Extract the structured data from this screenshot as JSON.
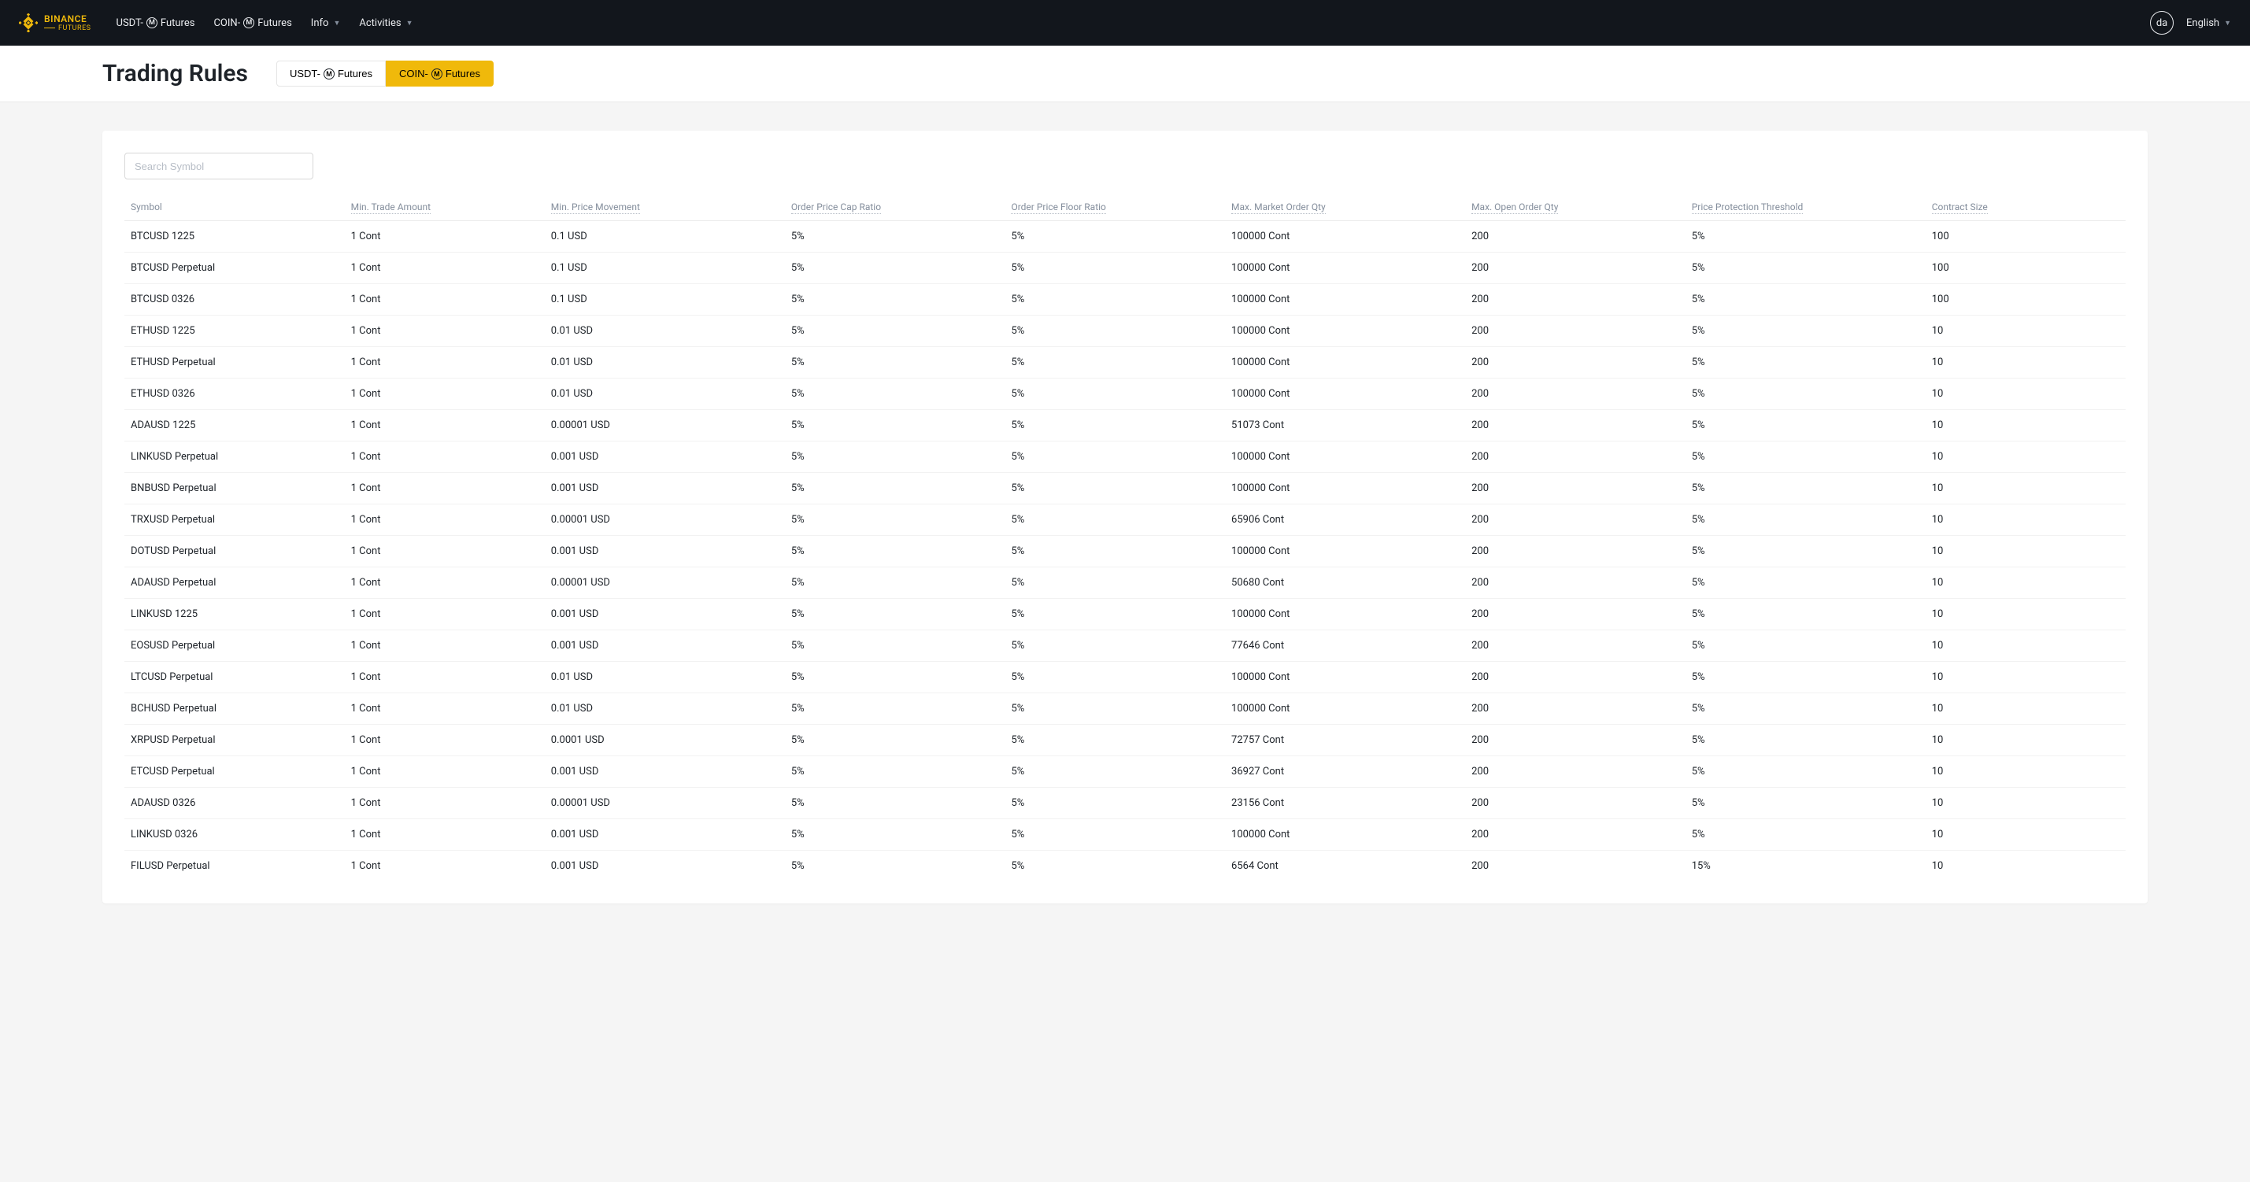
{
  "nav": {
    "logo_l1": "BINANCE",
    "logo_l2": "FUTURES",
    "items": [
      {
        "pre": "USDT-",
        "badge": "M",
        "post": " Futures"
      },
      {
        "pre": "COIN-",
        "badge": "M",
        "post": " Futures"
      },
      {
        "pre": "Info",
        "badge": "",
        "post": "",
        "caret": true
      },
      {
        "pre": "Activities",
        "badge": "",
        "post": "",
        "caret": true
      }
    ],
    "avatar": "da",
    "lang": "English"
  },
  "subheader": {
    "title": "Trading Rules",
    "tabs": [
      {
        "pre": "USDT-",
        "badge": "M",
        "post": " Futures",
        "active": false
      },
      {
        "pre": "COIN-",
        "badge": "M",
        "post": " Futures",
        "active": true
      }
    ]
  },
  "search": {
    "placeholder": "Search Symbol"
  },
  "table": {
    "headers": [
      "Symbol",
      "Min. Trade Amount",
      "Min. Price Movement",
      "Order Price Cap Ratio",
      "Order Price Floor Ratio",
      "Max. Market Order Qty",
      "Max. Open Order Qty",
      "Price Protection Threshold",
      "Contract Size"
    ],
    "rows": [
      {
        "symbol": "BTCUSD 1225",
        "minTrade": "1 Cont",
        "minPrice": "0.1 USD",
        "capRatio": "5%",
        "floorRatio": "5%",
        "maxMarket": "100000 Cont",
        "maxOpen": "200",
        "priceProt": "5%",
        "contractSize": "100"
      },
      {
        "symbol": "BTCUSD Perpetual",
        "minTrade": "1 Cont",
        "minPrice": "0.1 USD",
        "capRatio": "5%",
        "floorRatio": "5%",
        "maxMarket": "100000 Cont",
        "maxOpen": "200",
        "priceProt": "5%",
        "contractSize": "100"
      },
      {
        "symbol": "BTCUSD 0326",
        "minTrade": "1 Cont",
        "minPrice": "0.1 USD",
        "capRatio": "5%",
        "floorRatio": "5%",
        "maxMarket": "100000 Cont",
        "maxOpen": "200",
        "priceProt": "5%",
        "contractSize": "100"
      },
      {
        "symbol": "ETHUSD 1225",
        "minTrade": "1 Cont",
        "minPrice": "0.01 USD",
        "capRatio": "5%",
        "floorRatio": "5%",
        "maxMarket": "100000 Cont",
        "maxOpen": "200",
        "priceProt": "5%",
        "contractSize": "10"
      },
      {
        "symbol": "ETHUSD Perpetual",
        "minTrade": "1 Cont",
        "minPrice": "0.01 USD",
        "capRatio": "5%",
        "floorRatio": "5%",
        "maxMarket": "100000 Cont",
        "maxOpen": "200",
        "priceProt": "5%",
        "contractSize": "10"
      },
      {
        "symbol": "ETHUSD 0326",
        "minTrade": "1 Cont",
        "minPrice": "0.01 USD",
        "capRatio": "5%",
        "floorRatio": "5%",
        "maxMarket": "100000 Cont",
        "maxOpen": "200",
        "priceProt": "5%",
        "contractSize": "10"
      },
      {
        "symbol": "ADAUSD 1225",
        "minTrade": "1 Cont",
        "minPrice": "0.00001 USD",
        "capRatio": "5%",
        "floorRatio": "5%",
        "maxMarket": "51073 Cont",
        "maxOpen": "200",
        "priceProt": "5%",
        "contractSize": "10"
      },
      {
        "symbol": "LINKUSD Perpetual",
        "minTrade": "1 Cont",
        "minPrice": "0.001 USD",
        "capRatio": "5%",
        "floorRatio": "5%",
        "maxMarket": "100000 Cont",
        "maxOpen": "200",
        "priceProt": "5%",
        "contractSize": "10"
      },
      {
        "symbol": "BNBUSD Perpetual",
        "minTrade": "1 Cont",
        "minPrice": "0.001 USD",
        "capRatio": "5%",
        "floorRatio": "5%",
        "maxMarket": "100000 Cont",
        "maxOpen": "200",
        "priceProt": "5%",
        "contractSize": "10"
      },
      {
        "symbol": "TRXUSD Perpetual",
        "minTrade": "1 Cont",
        "minPrice": "0.00001 USD",
        "capRatio": "5%",
        "floorRatio": "5%",
        "maxMarket": "65906 Cont",
        "maxOpen": "200",
        "priceProt": "5%",
        "contractSize": "10"
      },
      {
        "symbol": "DOTUSD Perpetual",
        "minTrade": "1 Cont",
        "minPrice": "0.001 USD",
        "capRatio": "5%",
        "floorRatio": "5%",
        "maxMarket": "100000 Cont",
        "maxOpen": "200",
        "priceProt": "5%",
        "contractSize": "10"
      },
      {
        "symbol": "ADAUSD Perpetual",
        "minTrade": "1 Cont",
        "minPrice": "0.00001 USD",
        "capRatio": "5%",
        "floorRatio": "5%",
        "maxMarket": "50680 Cont",
        "maxOpen": "200",
        "priceProt": "5%",
        "contractSize": "10"
      },
      {
        "symbol": "LINKUSD 1225",
        "minTrade": "1 Cont",
        "minPrice": "0.001 USD",
        "capRatio": "5%",
        "floorRatio": "5%",
        "maxMarket": "100000 Cont",
        "maxOpen": "200",
        "priceProt": "5%",
        "contractSize": "10"
      },
      {
        "symbol": "EOSUSD Perpetual",
        "minTrade": "1 Cont",
        "minPrice": "0.001 USD",
        "capRatio": "5%",
        "floorRatio": "5%",
        "maxMarket": "77646 Cont",
        "maxOpen": "200",
        "priceProt": "5%",
        "contractSize": "10"
      },
      {
        "symbol": "LTCUSD Perpetual",
        "minTrade": "1 Cont",
        "minPrice": "0.01 USD",
        "capRatio": "5%",
        "floorRatio": "5%",
        "maxMarket": "100000 Cont",
        "maxOpen": "200",
        "priceProt": "5%",
        "contractSize": "10"
      },
      {
        "symbol": "BCHUSD Perpetual",
        "minTrade": "1 Cont",
        "minPrice": "0.01 USD",
        "capRatio": "5%",
        "floorRatio": "5%",
        "maxMarket": "100000 Cont",
        "maxOpen": "200",
        "priceProt": "5%",
        "contractSize": "10"
      },
      {
        "symbol": "XRPUSD Perpetual",
        "minTrade": "1 Cont",
        "minPrice": "0.0001 USD",
        "capRatio": "5%",
        "floorRatio": "5%",
        "maxMarket": "72757 Cont",
        "maxOpen": "200",
        "priceProt": "5%",
        "contractSize": "10"
      },
      {
        "symbol": "ETCUSD Perpetual",
        "minTrade": "1 Cont",
        "minPrice": "0.001 USD",
        "capRatio": "5%",
        "floorRatio": "5%",
        "maxMarket": "36927 Cont",
        "maxOpen": "200",
        "priceProt": "5%",
        "contractSize": "10"
      },
      {
        "symbol": "ADAUSD 0326",
        "minTrade": "1 Cont",
        "minPrice": "0.00001 USD",
        "capRatio": "5%",
        "floorRatio": "5%",
        "maxMarket": "23156 Cont",
        "maxOpen": "200",
        "priceProt": "5%",
        "contractSize": "10"
      },
      {
        "symbol": "LINKUSD 0326",
        "minTrade": "1 Cont",
        "minPrice": "0.001 USD",
        "capRatio": "5%",
        "floorRatio": "5%",
        "maxMarket": "100000 Cont",
        "maxOpen": "200",
        "priceProt": "5%",
        "contractSize": "10"
      },
      {
        "symbol": "FILUSD Perpetual",
        "minTrade": "1 Cont",
        "minPrice": "0.001 USD",
        "capRatio": "5%",
        "floorRatio": "5%",
        "maxMarket": "6564 Cont",
        "maxOpen": "200",
        "priceProt": "15%",
        "contractSize": "10"
      }
    ]
  }
}
